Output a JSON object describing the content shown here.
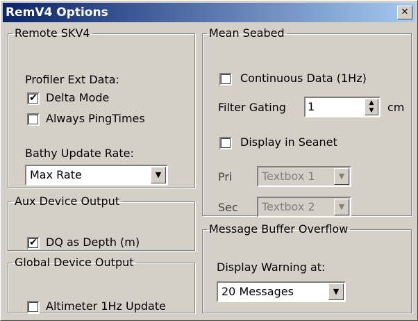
{
  "window": {
    "title": "RemV4 Options",
    "close_glyph": "✕"
  },
  "remote_skv4": {
    "legend": "Remote SKV4",
    "profiler_label": "Profiler Ext Data:",
    "delta_mode": {
      "label": "Delta Mode",
      "checked": true,
      "mark": "✔"
    },
    "always_ping_times": {
      "label": "Always PingTimes",
      "checked": false,
      "mark": ""
    },
    "bathy_label": "Bathy Update Rate:",
    "bathy_value": "Max Rate",
    "arrow": "▼"
  },
  "aux_device_output": {
    "legend": "Aux Device Output",
    "dq_as_depth": {
      "label": "DQ as Depth (m)",
      "checked": true,
      "mark": "✔"
    }
  },
  "global_device_output": {
    "legend": "Global Device Output",
    "altimeter": {
      "label": "Altimeter 1Hz Update",
      "checked": false,
      "mark": ""
    }
  },
  "mean_seabed": {
    "legend": "Mean Seabed",
    "continuous": {
      "label": "Continuous Data (1Hz)",
      "checked": false,
      "mark": ""
    },
    "filter_gating_label": "Filter Gating",
    "filter_gating_value": "1",
    "filter_unit": "cm",
    "spin_up": "▲",
    "spin_down": "▼",
    "display_in_seanet": {
      "label": "Display in Seanet",
      "checked": false,
      "mark": ""
    },
    "pri_label": "Pri",
    "pri_value": "Textbox 1",
    "sec_label": "Sec",
    "sec_value": "Textbox 2",
    "arrow": "▼"
  },
  "message_buffer_overflow": {
    "legend": "Message Buffer Overflow",
    "warning_label": "Display Warning at:",
    "warning_value": "20 Messages",
    "arrow": "▼"
  }
}
